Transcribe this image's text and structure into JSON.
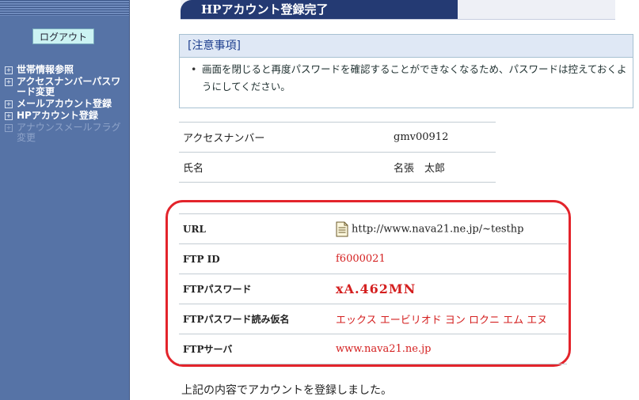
{
  "sidebar": {
    "logout_label": "ログアウト",
    "items": [
      {
        "label": "世帯情報参照",
        "enabled": true
      },
      {
        "label": "アクセスナンバーパスワード変更",
        "enabled": true
      },
      {
        "label": "メールアカウント登録",
        "enabled": true
      },
      {
        "label": "HPアカウント登録",
        "enabled": true
      },
      {
        "label": "アナウンスメールフラグ変更",
        "enabled": false
      }
    ]
  },
  "header": {
    "title": "HPアカウント登録完了"
  },
  "notice": {
    "title": "[注意事項]",
    "items": [
      "画面を閉じると再度パスワードを確認することができなくなるため、パスワードは控えておくようにしてください。"
    ]
  },
  "info": {
    "rows": [
      {
        "label": "アクセスナンバー",
        "value": "gmv00912"
      },
      {
        "label": "氏名",
        "value": "名張　太郎"
      }
    ]
  },
  "account": {
    "rows": [
      {
        "label": "URL",
        "value": "http://www.nava21.ne.jp/~testhp"
      },
      {
        "label": "FTP ID",
        "value": "f6000021"
      },
      {
        "label": "FTPパスワード",
        "value": "xA.462MN"
      },
      {
        "label": "FTPパスワード読み仮名",
        "value": "エックス エービリオド ヨン ロクニ エム エヌ"
      },
      {
        "label": "FTPサーバ",
        "value": "www.nava21.ne.jp"
      }
    ]
  },
  "footer": {
    "message": "上記の内容でアカウントを登録しました。"
  },
  "colors": {
    "sidebar": "#5673a6",
    "header_tab": "#243a73",
    "highlight": "#e3242b",
    "value_red": "#d41f1f"
  }
}
